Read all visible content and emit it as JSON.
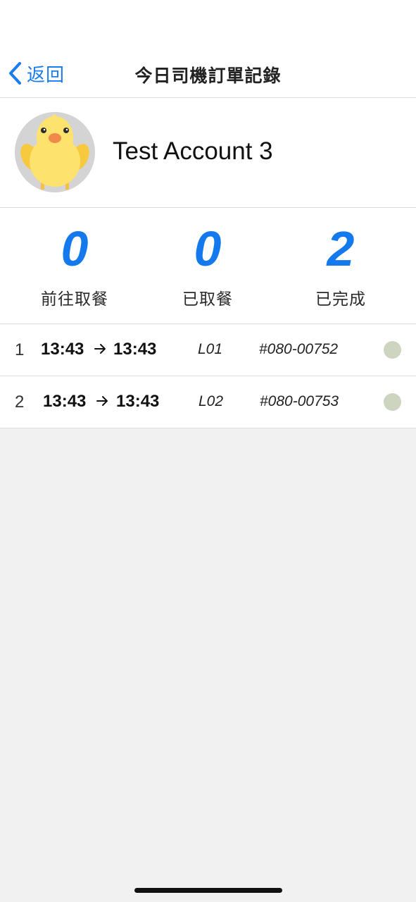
{
  "nav": {
    "back_label": "返回",
    "title": "今日司機訂單記錄"
  },
  "profile": {
    "name": "Test Account 3",
    "avatar_icon": "chick-avatar-icon"
  },
  "stats": [
    {
      "value": "0",
      "label": "前往取餐"
    },
    {
      "value": "0",
      "label": "已取餐"
    },
    {
      "value": "2",
      "label": "已完成"
    }
  ],
  "orders": [
    {
      "index": "1",
      "start_time": "13:43",
      "end_time": "13:43",
      "lane": "L01",
      "order_number": "#080-00752",
      "status_color": "#cdd4bf"
    },
    {
      "index": "2",
      "start_time": "13:43",
      "end_time": "13:43",
      "lane": "L02",
      "order_number": "#080-00753",
      "status_color": "#cdd4bf"
    }
  ],
  "colors": {
    "accent": "#1579ee",
    "background": "#f1f1f1"
  }
}
